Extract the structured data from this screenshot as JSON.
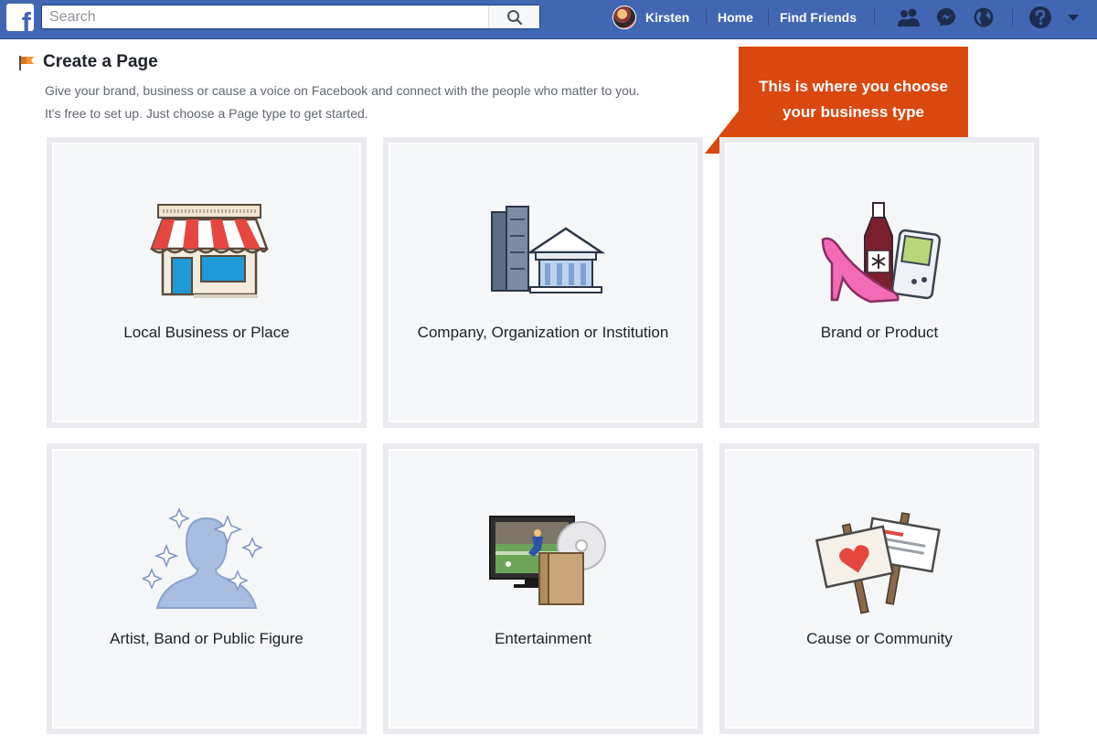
{
  "topbar": {
    "logo": "f",
    "search_placeholder": "Search",
    "user_name": "Kirsten",
    "home": "Home",
    "find_friends": "Find Friends",
    "icons": [
      "friend-requests-icon",
      "messenger-icon",
      "globe-icon",
      "help-icon",
      "dropdown-arrow-icon"
    ]
  },
  "page": {
    "title": "Create a Page",
    "description_line1": "Give your brand, business or cause a voice on Facebook and connect with the people who matter to you.",
    "description_line2": "It's free to set up. Just choose a Page type to get started."
  },
  "callout": {
    "text": "This is where you choose your business type"
  },
  "cards": [
    {
      "label": "Local Business or Place",
      "icon": "storefront-icon"
    },
    {
      "label": "Company, Organization or Institution",
      "icon": "buildings-icon"
    },
    {
      "label": "Brand or Product",
      "icon": "products-icon"
    },
    {
      "label": "Artist, Band or Public Figure",
      "icon": "public-figure-icon"
    },
    {
      "label": "Entertainment",
      "icon": "entertainment-icon"
    },
    {
      "label": "Cause or Community",
      "icon": "signs-icon"
    }
  ],
  "colors": {
    "brand": "#4267b2",
    "callout": "#d9480f",
    "card_bg": "#f5f6f7"
  }
}
